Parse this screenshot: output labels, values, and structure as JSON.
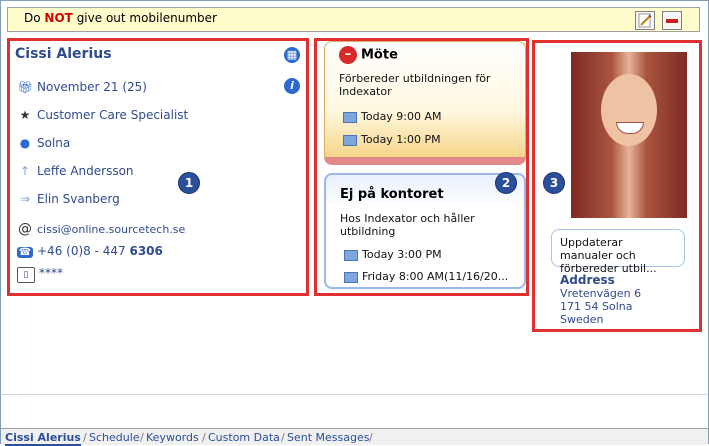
{
  "note": {
    "text_prefix": "Do",
    "text_emph": "NOT",
    "text_suffix": "give out mobilenumber",
    "edit_icon": "pencil-icon",
    "delete_icon": "delete-icon"
  },
  "contact": {
    "name": "Cissi Alerius",
    "birthday": "November 21 (25)",
    "title": "Customer Care Specialist",
    "location": "Solna",
    "manager": "Leffe Andersson",
    "substitute": "Elin Svanberg",
    "email": "cissi@online.sourcetech.se",
    "phone_prefix": "+46 (0)8 - 447",
    "phone_ext": "6306",
    "mobile": "****",
    "icons": {
      "birthday": "gift-icon",
      "title": "star-icon",
      "location": "map-pin-icon",
      "manager": "arrow-up-icon",
      "substitute": "arrow-right-icon",
      "email": "at-icon",
      "phone": "phone-icon",
      "mobile": "mobile-icon"
    }
  },
  "callouts": {
    "one": "1",
    "two": "2",
    "three": "3"
  },
  "calendar": [
    {
      "title": "Möte",
      "icon": "no-entry-icon",
      "description": "Förbereder utbildningen för Indexator",
      "start": "Today 9:00 AM",
      "end": "Today 1:00 PM"
    },
    {
      "title": "Ej på kontoret",
      "description": "Hos Indexator och håller utbildning",
      "start": "Today 3:00 PM",
      "end": "Friday 8:00 AM(11/16/20..."
    }
  ],
  "profile": {
    "status": "Uppdaterar manualer och förbereder utbil...",
    "address_label": "Address",
    "street": "Vretenvägen 6",
    "postal": "171 54 Solna",
    "country": "Sweden"
  },
  "tabs": [
    "Cissi Alerius",
    "Schedule",
    "Keywords",
    "Custom Data",
    "Sent Messages"
  ],
  "colors": {
    "accent": "#2f4b8c",
    "highlight": "#e03030",
    "note_bg": "#fffccc"
  }
}
